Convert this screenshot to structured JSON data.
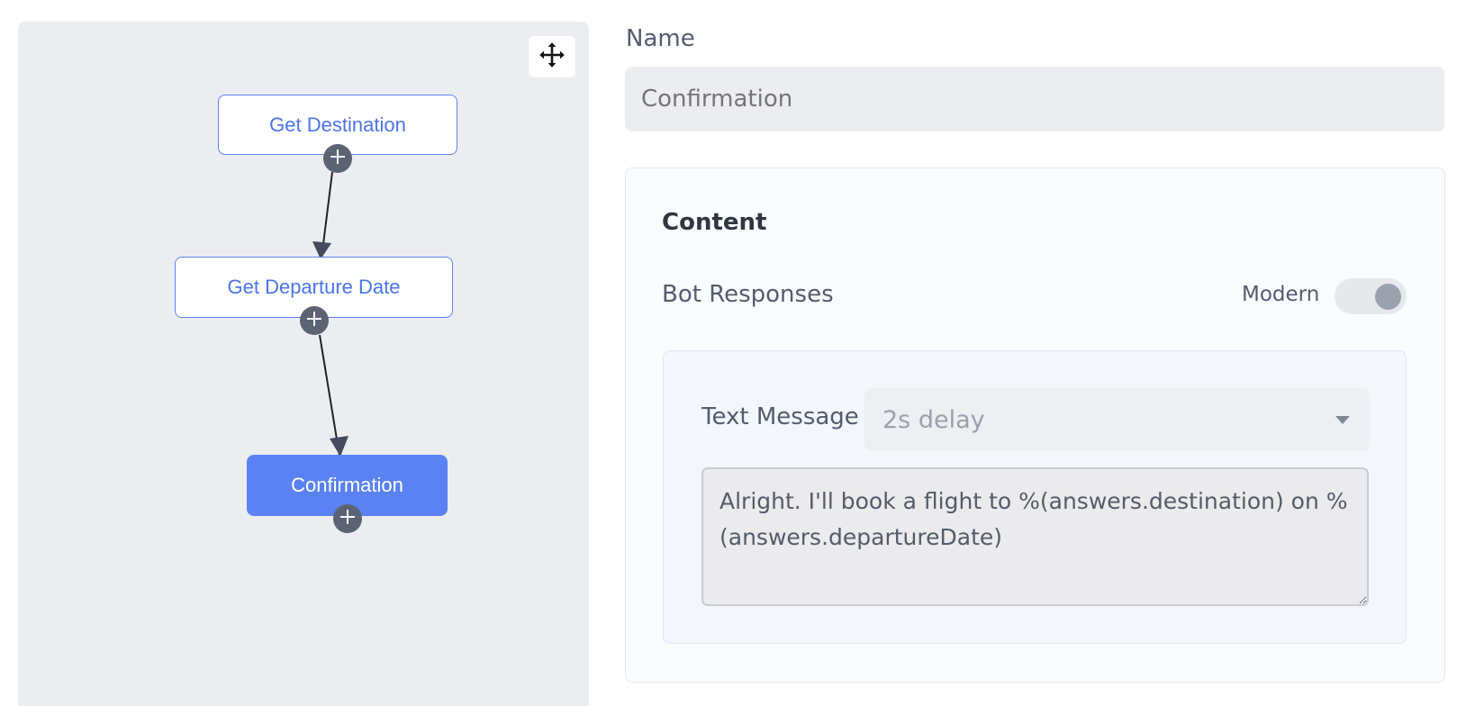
{
  "flow": {
    "nodes": [
      {
        "label": "Get Destination",
        "active": false
      },
      {
        "label": "Get Departure Date",
        "active": false
      },
      {
        "label": "Confirmation",
        "active": true
      }
    ],
    "move_icon": "move-arrows-icon",
    "add_icon": "plus-circle-icon"
  },
  "properties": {
    "name_label": "Name",
    "name_value": "Confirmation",
    "content_title": "Content",
    "bot_responses_label": "Bot Responses",
    "modern_label": "Modern",
    "modern_enabled": false,
    "response": {
      "type_label": "Text Message",
      "delay": "2s delay",
      "message": "Alright. I'll book a flight to %(answers.destination) on %(answers.departureDate)"
    }
  },
  "colors": {
    "accent": "#5a82f2",
    "canvas_bg": "#ebedf1",
    "text_primary": "#535b6e"
  }
}
